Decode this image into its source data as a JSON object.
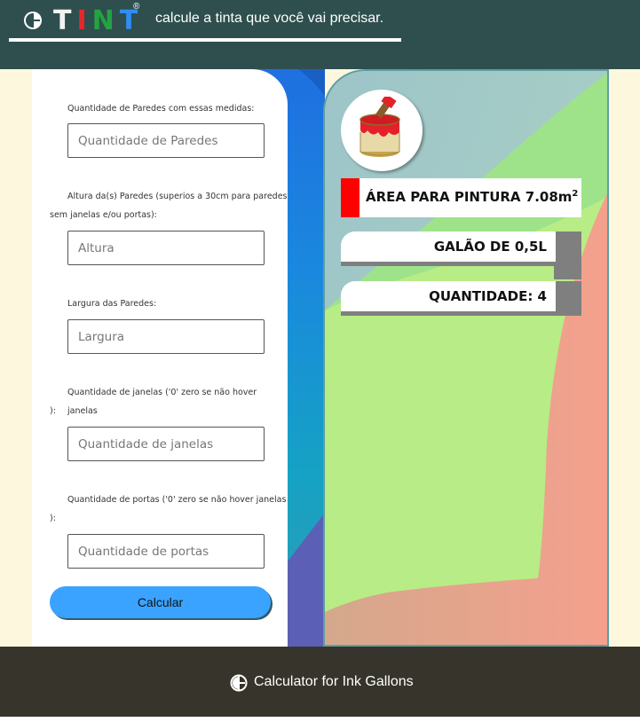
{
  "header": {
    "logo_letters": [
      "T",
      "I",
      "N",
      "T"
    ],
    "registered_mark": "®",
    "tagline": "calcule a tinta que você vai precisar."
  },
  "form": {
    "walls_label": "Quantidade de Paredes com essas medidas:",
    "walls_placeholder": "Quantidade de Paredes",
    "height_label_line1": "Altura da(s) Paredes (superios a 30cm para paredes",
    "height_label_line2": "sem janelas e/ou portas):",
    "height_placeholder": "Altura",
    "width_label": "Largura das Paredes:",
    "width_placeholder": "Largura",
    "windows_label_line1": "Quantidade de janelas ('0' zero se não hover janelas",
    "windows_label_line2": "):",
    "windows_placeholder": "Quantidade de janelas",
    "doors_label_line1": "Quantidade de portas ('0' zero se não hover janelas",
    "doors_label_line2": "):",
    "doors_placeholder": "Quantidade de portas",
    "calculate_label": "Calcular"
  },
  "result": {
    "area_label": "ÁREA PARA PINTURA 7.08m",
    "area_superscript": "2",
    "gallon_label": "GALÃO DE 0,5L",
    "quantity_label": "QUANTIDADE: 4"
  },
  "footer": {
    "text": "Calculator for Ink Gallons"
  },
  "colors": {
    "header_bg": "#2f4f4f",
    "footer_bg": "#36342b",
    "page_bg": "#fdf7de",
    "button_blue": "#3aa3ff",
    "area_red": "#ff0000",
    "logo_t": "#f2f2f2",
    "logo_i": "#e8262a",
    "logo_n": "#25a244",
    "logo_t2": "#2f8ef2"
  },
  "icons": {
    "logo": "half-circle-logo-icon",
    "paint": "paint-can-brush-icon",
    "footer": "half-circle-logo-icon"
  }
}
